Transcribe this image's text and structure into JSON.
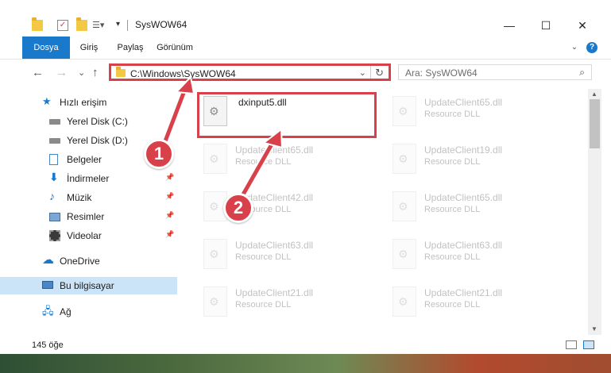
{
  "window": {
    "title": "SysWOW64",
    "minimize": "—",
    "maximize": "☐",
    "close": "✕"
  },
  "ribbon": {
    "tabs": [
      "Dosya",
      "Giriş",
      "Paylaş",
      "Görünüm"
    ],
    "help": "?"
  },
  "nav": {
    "back": "←",
    "forward": "→",
    "recent": "⌄",
    "up": "↑",
    "address": "C:\\Windows\\SysWOW64",
    "dropdown": "⌄",
    "refresh": "↻",
    "search_placeholder": "Ara: SysWOW64",
    "search_icon": "⌕"
  },
  "sidebar": {
    "items": [
      {
        "label": "Hızlı erişim",
        "icon": "star-icon",
        "pinned": false
      },
      {
        "label": "Yerel Disk (C:)",
        "icon": "drive-icon",
        "pinned": false
      },
      {
        "label": "Yerel Disk (D:)",
        "icon": "drive-icon",
        "pinned": false
      },
      {
        "label": "Belgeler",
        "icon": "document-icon",
        "pinned": true
      },
      {
        "label": "İndirmeler",
        "icon": "download-icon",
        "pinned": true
      },
      {
        "label": "Müzik",
        "icon": "music-icon",
        "pinned": true
      },
      {
        "label": "Resimler",
        "icon": "pictures-icon",
        "pinned": true
      },
      {
        "label": "Videolar",
        "icon": "video-icon",
        "pinned": true
      },
      {
        "label": "OneDrive",
        "icon": "cloud-icon",
        "pinned": false
      },
      {
        "label": "Bu bilgisayar",
        "icon": "computer-icon",
        "pinned": false
      },
      {
        "label": "Ağ",
        "icon": "network-icon",
        "pinned": false
      }
    ]
  },
  "files": {
    "selected": {
      "name": "dxinput5.dll",
      "type": ""
    },
    "left_column": [
      {
        "name": "UpdateClient65.dll",
        "type": "Resource DLL"
      },
      {
        "name": "UpdateClient42.dll",
        "type": "Resource DLL"
      },
      {
        "name": "UpdateClient63.dll",
        "type": "Resource DLL"
      },
      {
        "name": "UpdateClient21.dll",
        "type": "Resource DLL"
      }
    ],
    "right_column": [
      {
        "name": "UpdateClient65.dll",
        "type": "Resource DLL"
      },
      {
        "name": "UpdateClient19.dll",
        "type": "Resource DLL"
      },
      {
        "name": "UpdateClient65.dll",
        "type": "Resource DLL"
      },
      {
        "name": "UpdateClient63.dll",
        "type": "Resource DLL"
      },
      {
        "name": "UpdateClient21.dll",
        "type": "Resource DLL"
      }
    ]
  },
  "status": {
    "count": "145 öğe"
  },
  "callouts": [
    "1",
    "2"
  ],
  "colors": {
    "accent": "#1979ca",
    "highlight": "#d9414a",
    "selection": "#cce4f7"
  }
}
